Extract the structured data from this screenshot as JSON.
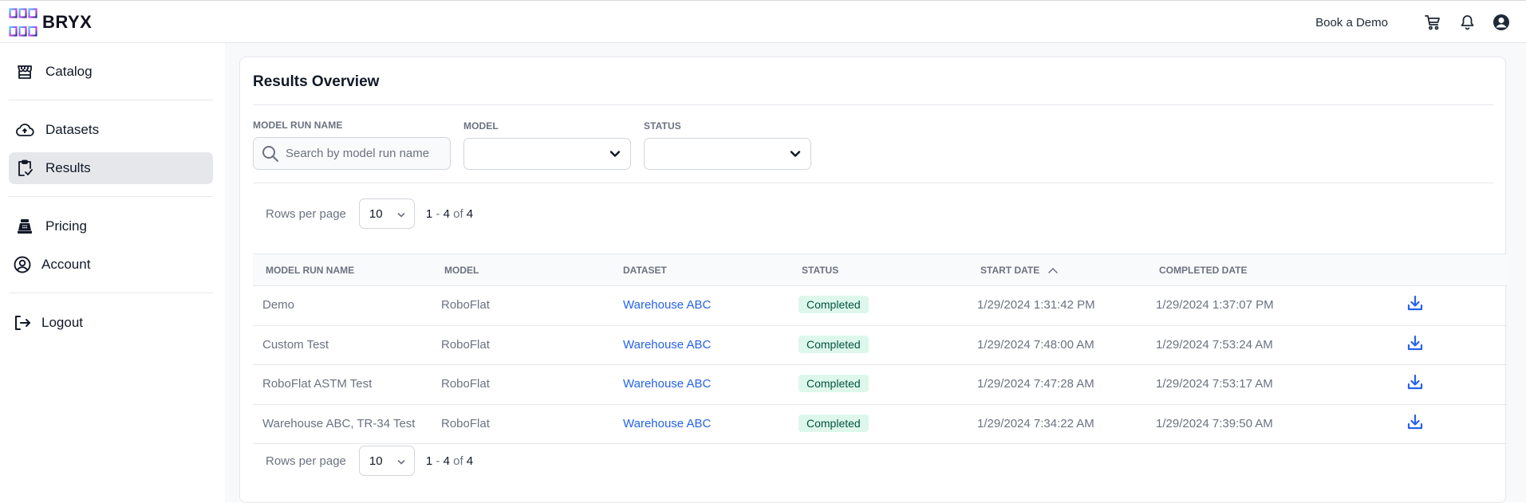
{
  "header": {
    "brand": "BRYX",
    "book_demo": "Book a Demo",
    "icons": [
      "cart-icon",
      "bell-icon",
      "user-circle-icon"
    ]
  },
  "sidebar": {
    "items": [
      {
        "label": "Catalog",
        "icon": "store-icon",
        "active": false
      },
      {
        "label": "Datasets",
        "icon": "cloud-upload-icon",
        "active": false
      },
      {
        "label": "Results",
        "icon": "clipboard-check-icon",
        "active": true
      },
      {
        "label": "Pricing",
        "icon": "cash-register-icon",
        "active": false
      },
      {
        "label": "Account",
        "icon": "user-circle-icon",
        "active": false
      },
      {
        "label": "Logout",
        "icon": "logout-icon",
        "active": false
      }
    ]
  },
  "main": {
    "title": "Results Overview",
    "filters": {
      "run_name_label": "MODEL RUN NAME",
      "run_name_placeholder": "Search by model run name",
      "run_name_value": "",
      "model_label": "MODEL",
      "model_value": "",
      "status_label": "STATUS",
      "status_value": ""
    },
    "pagination": {
      "rows_per_page_label": "Rows per page",
      "rows_per_page": "10",
      "range_start": "1",
      "range_sep": " - ",
      "range_end": "4",
      "of_label": " of ",
      "total": "4"
    },
    "table": {
      "columns": [
        "MODEL RUN NAME",
        "MODEL",
        "DATASET",
        "STATUS",
        "START DATE",
        "COMPLETED DATE"
      ],
      "sorted_column": "START DATE",
      "sort_direction": "ascending",
      "rows": [
        {
          "name": "Demo",
          "model": "RoboFlat",
          "dataset": "Warehouse ABC",
          "status": "Completed",
          "start": "1/29/2024 1:31:42 PM",
          "completed": "1/29/2024 1:37:07 PM"
        },
        {
          "name": "Custom Test",
          "model": "RoboFlat",
          "dataset": "Warehouse ABC",
          "status": "Completed",
          "start": "1/29/2024 7:48:00 AM",
          "completed": "1/29/2024 7:53:24 AM"
        },
        {
          "name": "RoboFlat ASTM Test",
          "model": "RoboFlat",
          "dataset": "Warehouse ABC",
          "status": "Completed",
          "start": "1/29/2024 7:47:28 AM",
          "completed": "1/29/2024 7:53:17 AM"
        },
        {
          "name": "Warehouse ABC, TR-34 Test",
          "model": "RoboFlat",
          "dataset": "Warehouse ABC",
          "status": "Completed",
          "start": "1/29/2024 7:34:22 AM",
          "completed": "1/29/2024 7:39:50 AM"
        }
      ]
    }
  },
  "colors": {
    "accent": "#2563eb",
    "badge_bg": "#def7ec",
    "badge_text": "#03543f",
    "active_nav": "#e5e7eb"
  }
}
